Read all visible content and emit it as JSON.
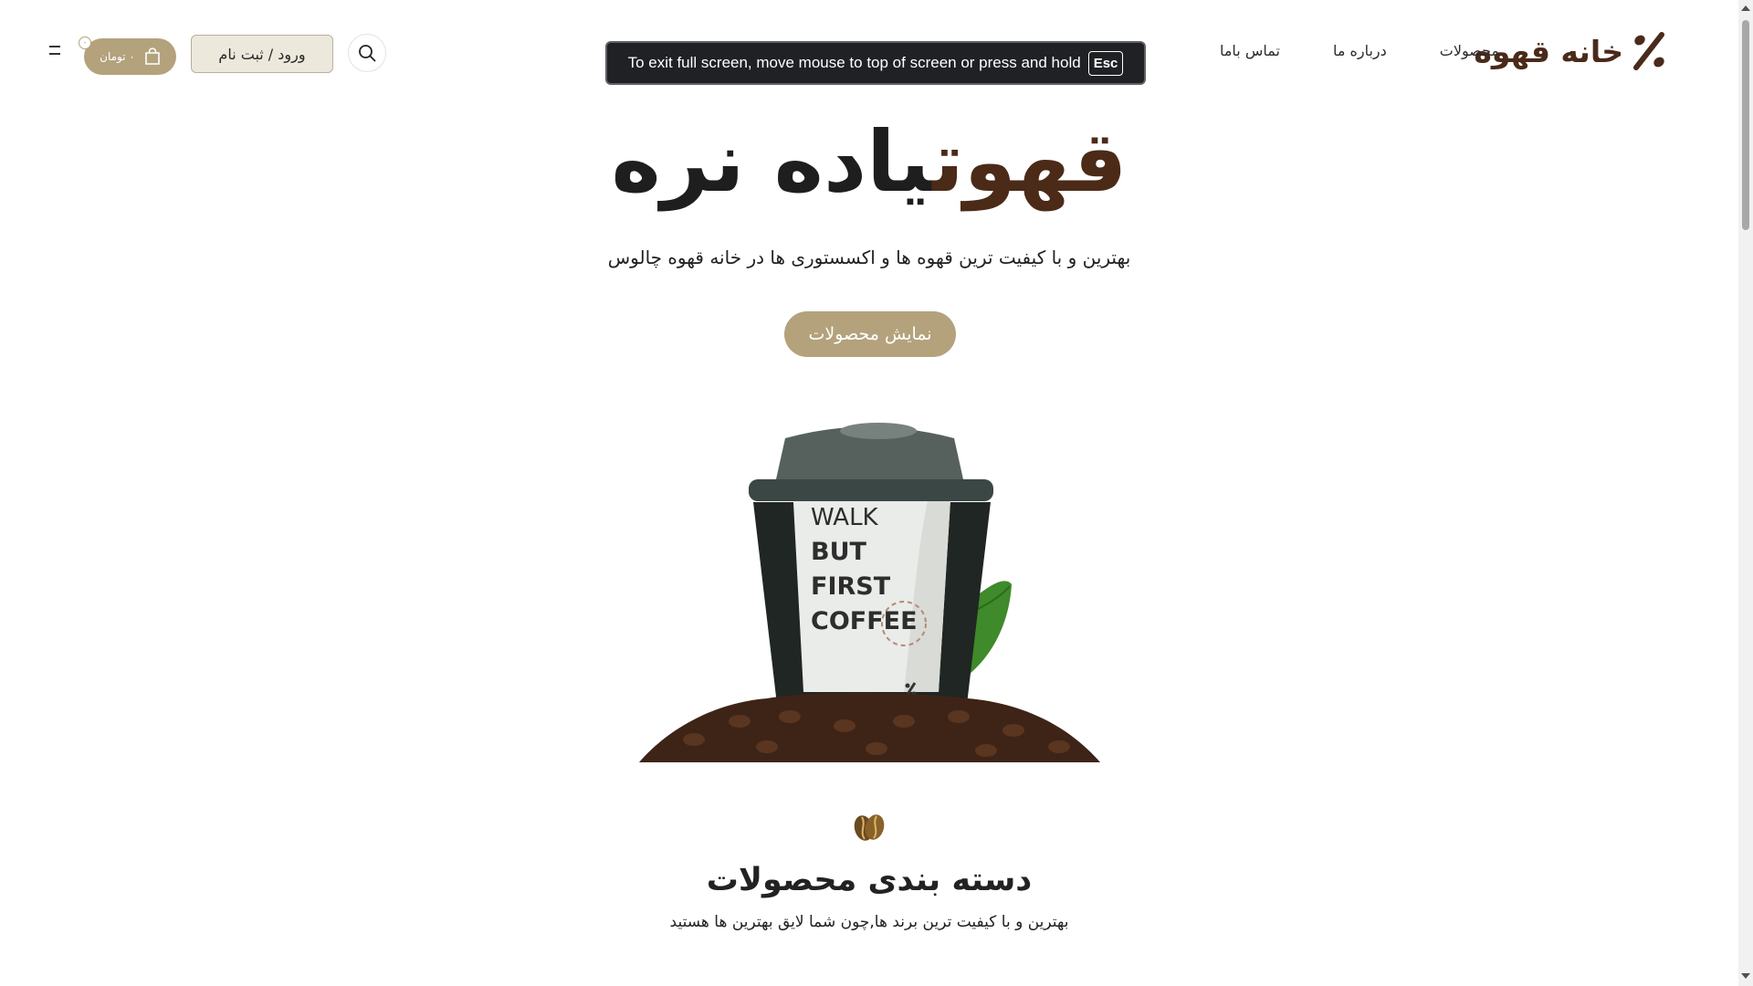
{
  "brand": {
    "name": "خانه قهوه",
    "color": "#4a2a1a"
  },
  "nav": {
    "items": [
      {
        "label": "محصولات"
      },
      {
        "label": "درباره ما"
      },
      {
        "label": "تماس باما"
      }
    ]
  },
  "fullscreen_notice": {
    "text": "To exit full screen, move mouse to top of screen or press and hold",
    "key": "Esc"
  },
  "header_actions": {
    "search_icon": "search-icon",
    "login_label": "ورود / ثبت نام",
    "cart_total": "۰ تومان",
    "cart_count": "۰",
    "cart_icon": "shopping-bag-icon",
    "menu_icon": "hamburger-icon"
  },
  "hero": {
    "title_accent": "قهوت",
    "title_rest": "یاده نره",
    "subtitle": "بهترین و با کیفیت ترین قهوه ها و اکسستوری ها در خانه قهوه چالوس",
    "cta_label": "نمایش محصولات",
    "cup_text": [
      "WALK",
      "BUT",
      "FIRST",
      "COFFEE"
    ]
  },
  "categories": {
    "icon": "coffee-bean-icon",
    "title": "دسته بندی محصولات",
    "subtitle": "بهترین و با کیفیت ترین برند ها,چون شما لایق بهترین ها هستید"
  },
  "colors": {
    "accent": "#b3a27c",
    "dark_brown": "#4b2a18",
    "login_bg": "#ece8dc"
  }
}
